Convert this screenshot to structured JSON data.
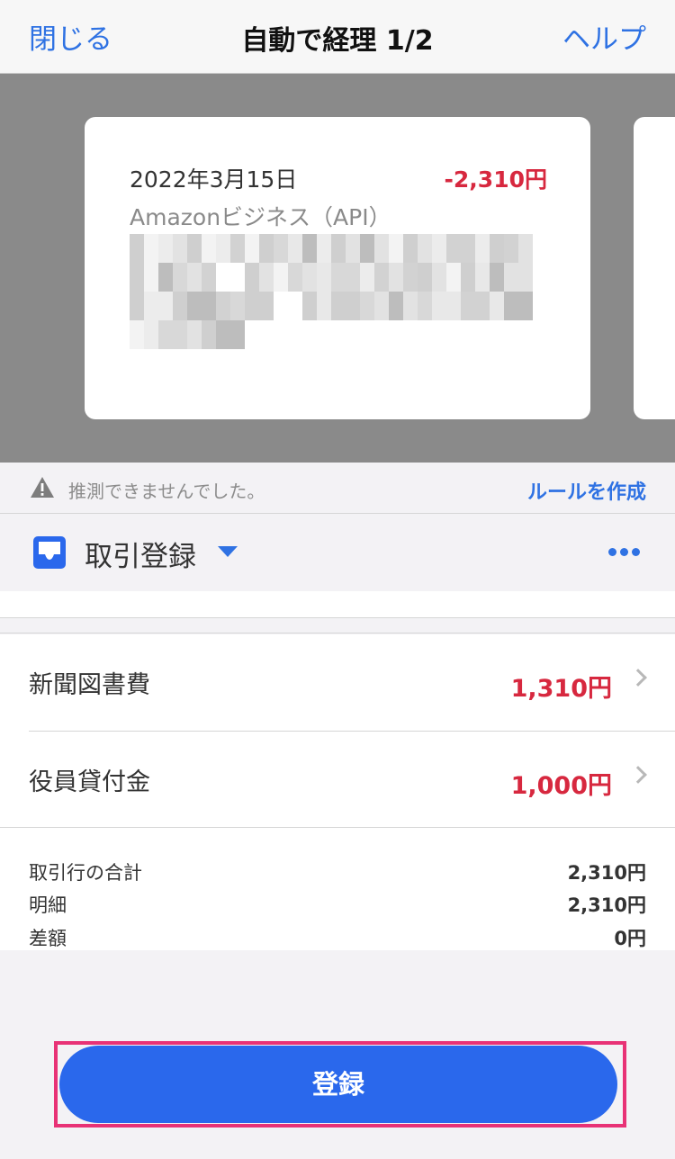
{
  "nav": {
    "close_label": "閉じる",
    "title": "自動で経理 1/2",
    "help_label": "ヘルプ"
  },
  "card": {
    "date": "2022年3月15日",
    "amount": "-2,310円",
    "merchant": "Amazonビジネス（API）",
    "description_redacted": true
  },
  "status": {
    "icon": "warning-icon",
    "message": "推測できませんでした。",
    "rule_link_label": "ルールを作成"
  },
  "transaction_type": {
    "icon": "inbox-icon",
    "label": "取引登録",
    "more_icon": "more-dots-icon"
  },
  "lines": [
    {
      "account": "新聞図書費",
      "amount": "1,310円"
    },
    {
      "account": "役員貸付金",
      "amount": "1,000円"
    }
  ],
  "summary": [
    {
      "label": "取引行の合計",
      "value": "2,310円"
    },
    {
      "label": "明細",
      "value": "2,310円"
    },
    {
      "label": "差額",
      "value": "0円"
    }
  ],
  "submit_label": "登録",
  "colors": {
    "accent": "#2f72e3",
    "button": "#2a68ec",
    "negative": "#d7283f",
    "highlight": "#e83276"
  }
}
